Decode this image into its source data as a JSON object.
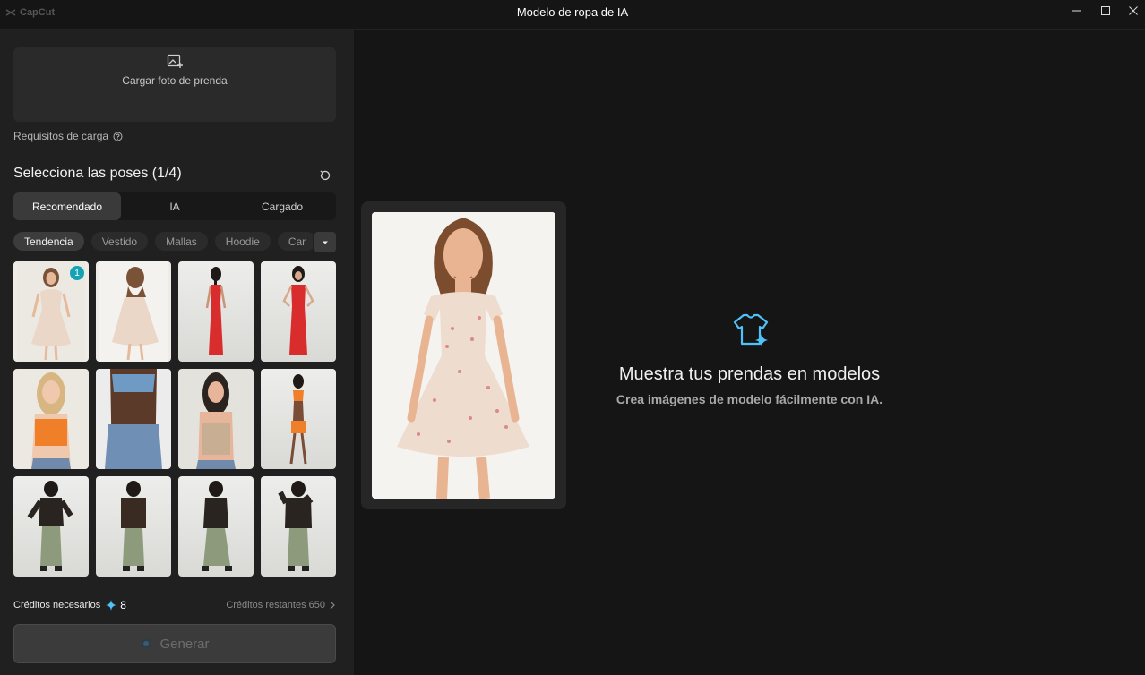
{
  "app": {
    "logo_text": "CapCut",
    "title": "Modelo de ropa de IA"
  },
  "upload": {
    "label": "Cargar foto de prenda",
    "requirements": "Requisitos de carga"
  },
  "poses": {
    "title": "Selecciona las poses (1/4)",
    "tabs": [
      "Recomendado",
      "IA",
      "Cargado"
    ],
    "active_tab": "Recomendado",
    "chips": [
      "Tendencia",
      "Vestido",
      "Mallas",
      "Hoodie",
      "Car"
    ],
    "active_chip": "Tendencia",
    "selected_badge": "1"
  },
  "credits": {
    "label": "Créditos necesarios",
    "value": "8",
    "remaining_label": "Créditos restantes 650"
  },
  "generate": {
    "label": "Generar"
  },
  "empty_state": {
    "title": "Muestra tus prendas en modelos",
    "subtitle": "Crea imágenes de modelo fácilmente con IA."
  },
  "colors": {
    "accent": "#14a3b4",
    "icon_blue": "#4fc3f7"
  }
}
